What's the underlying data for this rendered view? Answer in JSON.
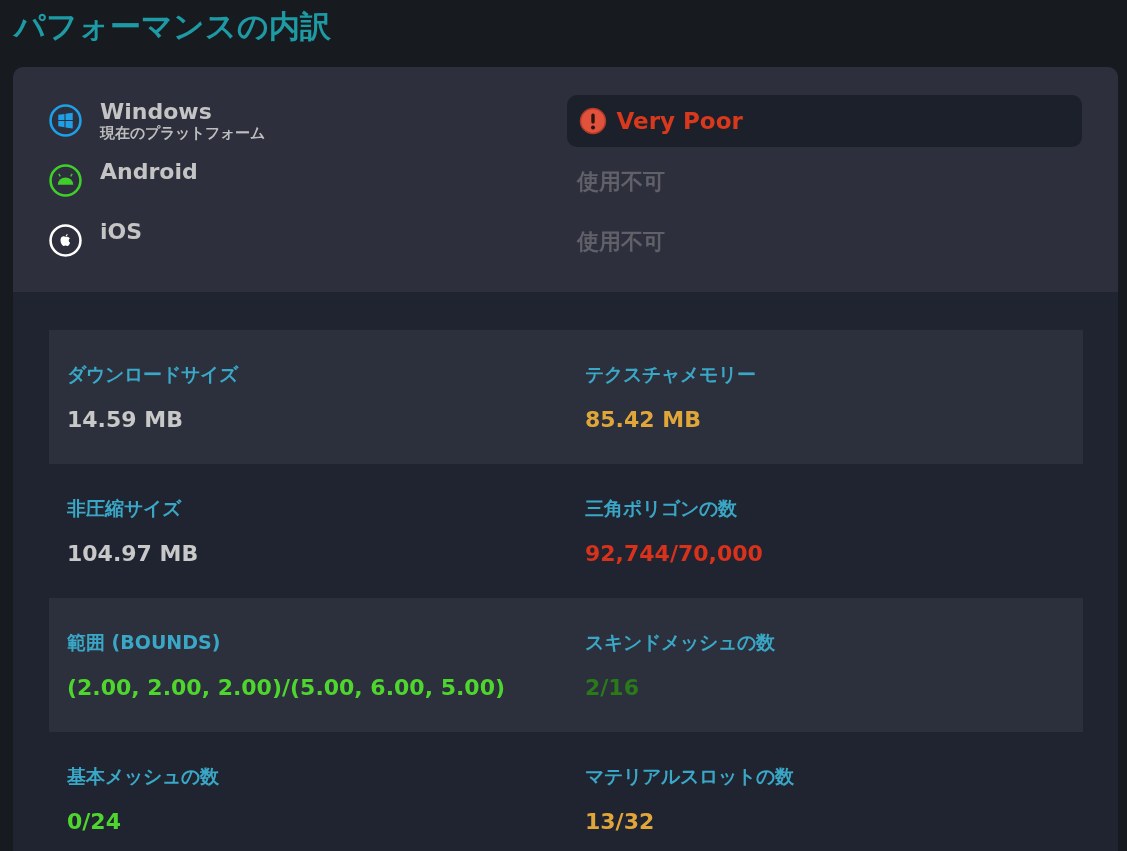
{
  "title": "パフォーマンスの内訳",
  "platforms": [
    {
      "kind": "windows",
      "name": "Windows",
      "subtitle": "現在のプラットフォーム",
      "rating": {
        "kind": "very_poor",
        "text": "Very Poor"
      }
    },
    {
      "kind": "android",
      "name": "Android",
      "rating": {
        "kind": "unavailable",
        "text": "使用不可"
      }
    },
    {
      "kind": "ios",
      "name": "iOS",
      "rating": {
        "kind": "unavailable",
        "text": "使用不可"
      }
    }
  ],
  "stats": [
    {
      "label": "ダウンロードサイズ",
      "value": "14.59 MB",
      "color": "#c8c8c8"
    },
    {
      "label": "テクスチャメモリー",
      "value": "85.42 MB",
      "color": "#e0a63a"
    },
    {
      "label": "非圧縮サイズ",
      "value": "104.97 MB",
      "color": "#c8c8c8"
    },
    {
      "label": "三角ポリゴンの数",
      "value": "92,744/70,000",
      "color": "#d8321c"
    },
    {
      "label": "範囲 (BOUNDS)",
      "value": "(2.00, 2.00, 2.00)/(5.00, 6.00, 5.00)",
      "color": "#4fd62e"
    },
    {
      "label": "スキンドメッシュの数",
      "value": "2/16",
      "color": "#2a7a1c"
    },
    {
      "label": "基本メッシュの数",
      "value": "0/24",
      "color": "#4fd62e"
    },
    {
      "label": "マテリアルスロットの数",
      "value": "13/32",
      "color": "#e0a63a"
    }
  ]
}
